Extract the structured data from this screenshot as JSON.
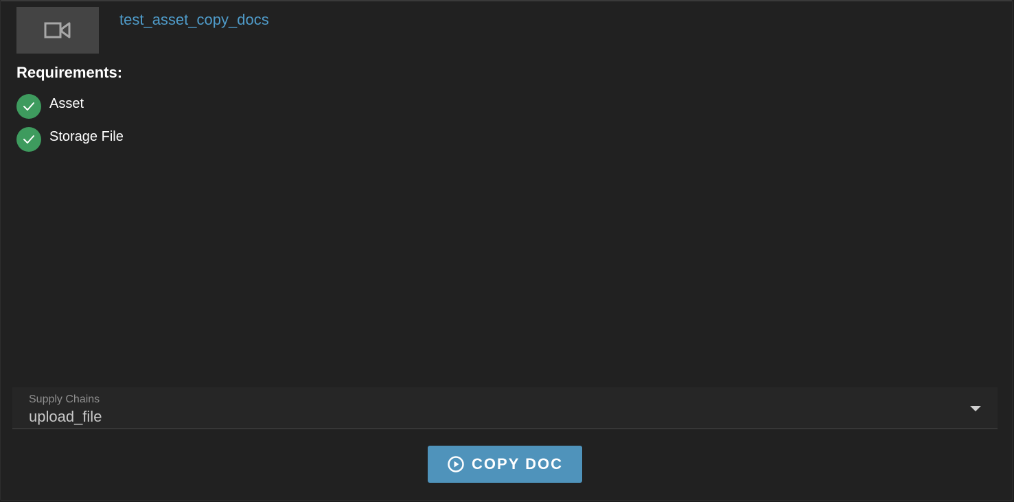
{
  "asset": {
    "thumbnail_icon": "video-camera-icon",
    "name": "test_asset_copy_docs"
  },
  "requirements": {
    "title": "Requirements:",
    "items": [
      {
        "label": "Asset",
        "status": "complete",
        "icon": "check-icon",
        "color": "#3e9b5e"
      },
      {
        "label": "Storage File",
        "status": "complete",
        "icon": "check-icon",
        "color": "#3e9b5e"
      }
    ]
  },
  "supply_chains": {
    "label": "Supply Chains",
    "value": "upload_file",
    "icon": "dropdown-arrow-icon"
  },
  "action": {
    "label": "COPY DOC",
    "icon": "play-circle-icon",
    "color": "#4f93bb"
  },
  "colors": {
    "background": "#212121",
    "link": "#4f9bc9",
    "success": "#3e9b5e"
  }
}
